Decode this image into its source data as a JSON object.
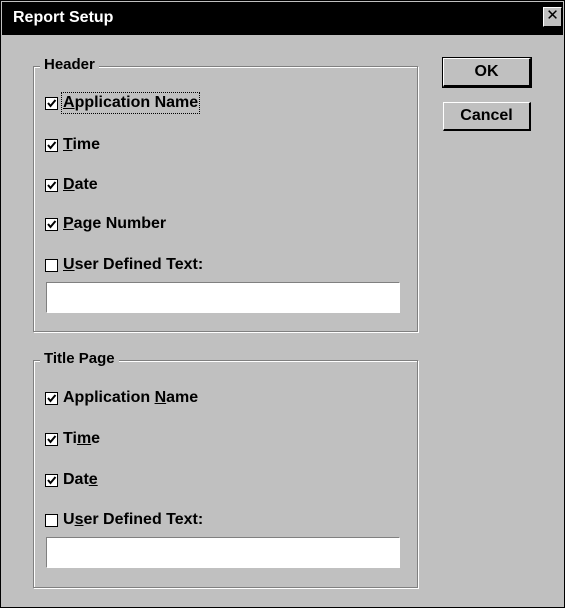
{
  "window": {
    "title": "Report Setup",
    "close_glyph": "✕"
  },
  "buttons": {
    "ok": "OK",
    "cancel": "Cancel"
  },
  "header": {
    "legend": "Header",
    "options": [
      {
        "id": "application-name",
        "pre": "",
        "key": "A",
        "post": "pplication Name",
        "checked": true,
        "focused": true
      },
      {
        "id": "time",
        "pre": "",
        "key": "T",
        "post": "ime",
        "checked": true,
        "focused": false
      },
      {
        "id": "date",
        "pre": "",
        "key": "D",
        "post": "ate",
        "checked": true,
        "focused": false
      },
      {
        "id": "page-number",
        "pre": "",
        "key": "P",
        "post": "age Number",
        "checked": true,
        "focused": false
      },
      {
        "id": "user-defined-text",
        "pre": "",
        "key": "U",
        "post": "ser Defined Text:",
        "checked": false,
        "focused": false
      }
    ],
    "user_text_value": ""
  },
  "title_page": {
    "legend": "Title Page",
    "options": [
      {
        "id": "application-name",
        "pre": "Application ",
        "key": "N",
        "post": "ame",
        "checked": true,
        "focused": false
      },
      {
        "id": "time",
        "pre": "Ti",
        "key": "m",
        "post": "e",
        "checked": true,
        "focused": false
      },
      {
        "id": "date",
        "pre": "Dat",
        "key": "e",
        "post": "",
        "checked": true,
        "focused": false
      },
      {
        "id": "user-defined-text",
        "pre": "U",
        "key": "s",
        "post": "er Defined Text:",
        "checked": false,
        "focused": false
      }
    ],
    "user_text_value": ""
  }
}
